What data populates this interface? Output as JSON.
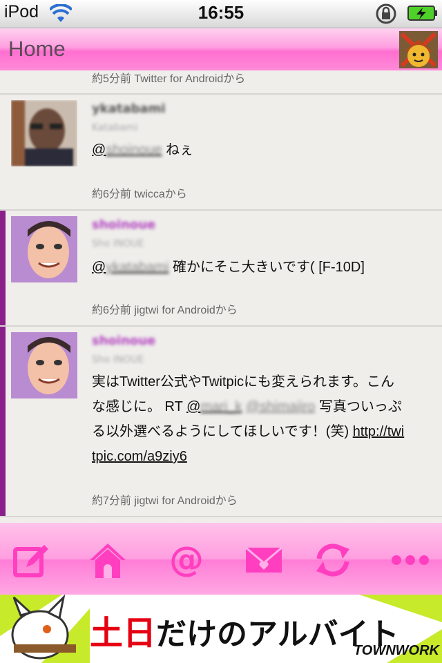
{
  "status": {
    "carrier": "iPod",
    "time": "16:55"
  },
  "nav": {
    "title": "Home"
  },
  "timeline": {
    "top_meta": "約5分前  Twitter for Androidから",
    "tweets": [
      {
        "username": "ykatabami",
        "fullname": "Katabami",
        "mention": "@",
        "mention_blur": "shoinoue",
        "text": " ねぇ",
        "meta": "約6分前  twiccaから"
      },
      {
        "username": "shoinoue",
        "fullname": "Sho INOUE",
        "mention": "@",
        "mention_blur": "ykatabami",
        "text": " 確かにそこ大きいです( [F-10D]",
        "meta": "約6分前  jigtwi for Androidから"
      },
      {
        "username": "shoinoue",
        "fullname": "Sho INOUE",
        "line1": "実はTwitter公式やTwitpicにも変えられます。こん",
        "line2_a": "な感じに。 RT ",
        "line2_m1": "@",
        "line2_m1_blur": "mari_k",
        "line2_m2_blur": "@shimajiro",
        "line2_b": " 写真ついっぷ",
        "line3_a": "る以外選べるようにしてほしいです！(笑) ",
        "line3_link": "http://twi",
        "line4_link": "tpic.com/a9ziy6",
        "meta": "約7分前  jigtwi for Androidから"
      }
    ]
  },
  "tabs": [
    "compose-icon",
    "home-icon",
    "mention-icon",
    "message-icon",
    "refresh-icon",
    "more-icon"
  ],
  "ad": {
    "red_text": "土日",
    "black_text": "だけのアルバイト",
    "brand": "TOWNWORK"
  },
  "colors": {
    "accent": "#ff3fbf",
    "marker": "#8a1f8a"
  }
}
